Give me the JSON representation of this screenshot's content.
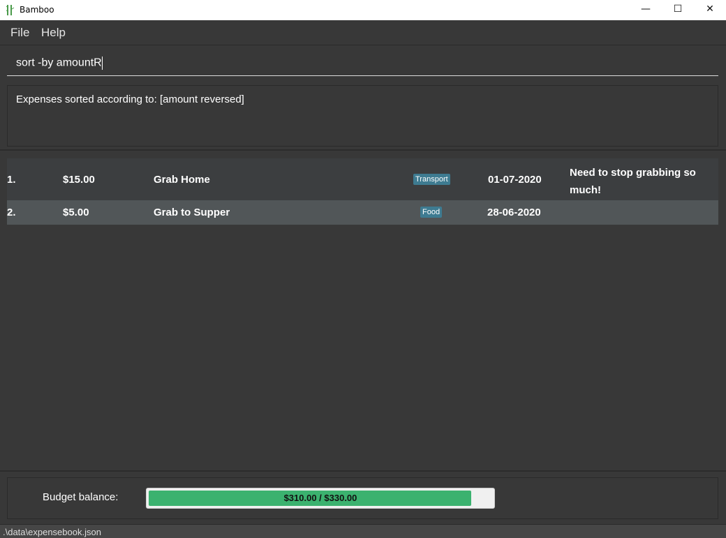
{
  "window": {
    "title": "Bamboo",
    "minimize": "—",
    "maximize": "☐",
    "close": "✕"
  },
  "menu": {
    "items": [
      "File",
      "Help"
    ]
  },
  "command": {
    "value": "sort -by amountR"
  },
  "result": {
    "text": "Expenses sorted according to: [amount reversed]"
  },
  "expenses": [
    {
      "index": "1.",
      "amount": "$15.00",
      "description": "Grab Home",
      "tag": "Transport",
      "date": "01-07-2020",
      "remark": "Need to stop grabbing so much!"
    },
    {
      "index": "2.",
      "amount": "$5.00",
      "description": "Grab to Supper",
      "tag": "Food",
      "date": "28-06-2020",
      "remark": ""
    }
  ],
  "budget": {
    "label": "Budget balance:",
    "text": "$310.00 / $330.00",
    "progress": 0.9394,
    "bar_color": "#3bb26f"
  },
  "status": {
    "path": ".\\data\\expensebook.json"
  },
  "colors": {
    "tag": "#3e7b91",
    "background": "#383838",
    "selected_row": "#515658"
  }
}
